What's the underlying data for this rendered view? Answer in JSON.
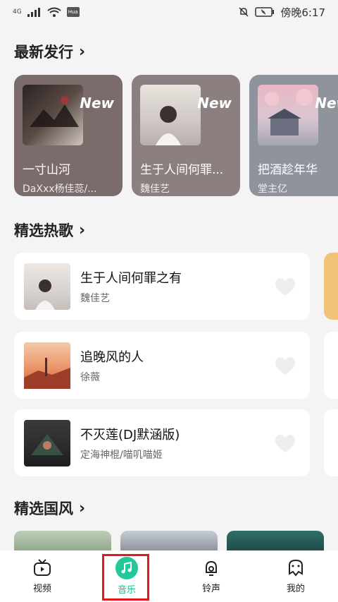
{
  "status": {
    "network": "4G",
    "brand": "Hua",
    "time_label": "傍晚6:17"
  },
  "sections": {
    "new_releases": "最新发行",
    "hot_songs": "精选热歌",
    "guofeng": "精选国风"
  },
  "releases": [
    {
      "title": "一寸山河",
      "artist": "DaXxx杨佳蕊/...",
      "tag": "New",
      "card_color": "#7b6b6b",
      "cover_colors": [
        "#2b2424",
        "#cfc6bf"
      ]
    },
    {
      "title": "生于人间何罪...",
      "artist": "魏佳艺",
      "tag": "New",
      "card_color": "#8c7f80",
      "cover_colors": [
        "#e9e3dc",
        "#b8aeb0"
      ]
    },
    {
      "title": "把酒趁年华",
      "artist": "堂主亿",
      "tag": "New",
      "card_color": "#8f949c",
      "cover_colors": [
        "#e8b7c3",
        "#a6a4b2"
      ]
    }
  ],
  "songs": [
    {
      "name": "生于人间何罪之有",
      "singer": "魏佳艺",
      "thumb": "#d9d3cf"
    },
    {
      "name": "追晚风的人",
      "singer": "徐薇",
      "thumb": "#e88f62"
    },
    {
      "name": "不灭莲(DJ默涵版)",
      "singer": "定海神棍/喵叽喵姬",
      "thumb": "#2b2b2b"
    }
  ],
  "nav": [
    {
      "label": "视频",
      "icon": "tv-icon"
    },
    {
      "label": "音乐",
      "icon": "music-note-icon"
    },
    {
      "label": "铃声",
      "icon": "bell-icon"
    },
    {
      "label": "我的",
      "icon": "face-icon"
    }
  ],
  "colors": {
    "accent": "#22c89a",
    "highlight_box": "#e0191a"
  }
}
